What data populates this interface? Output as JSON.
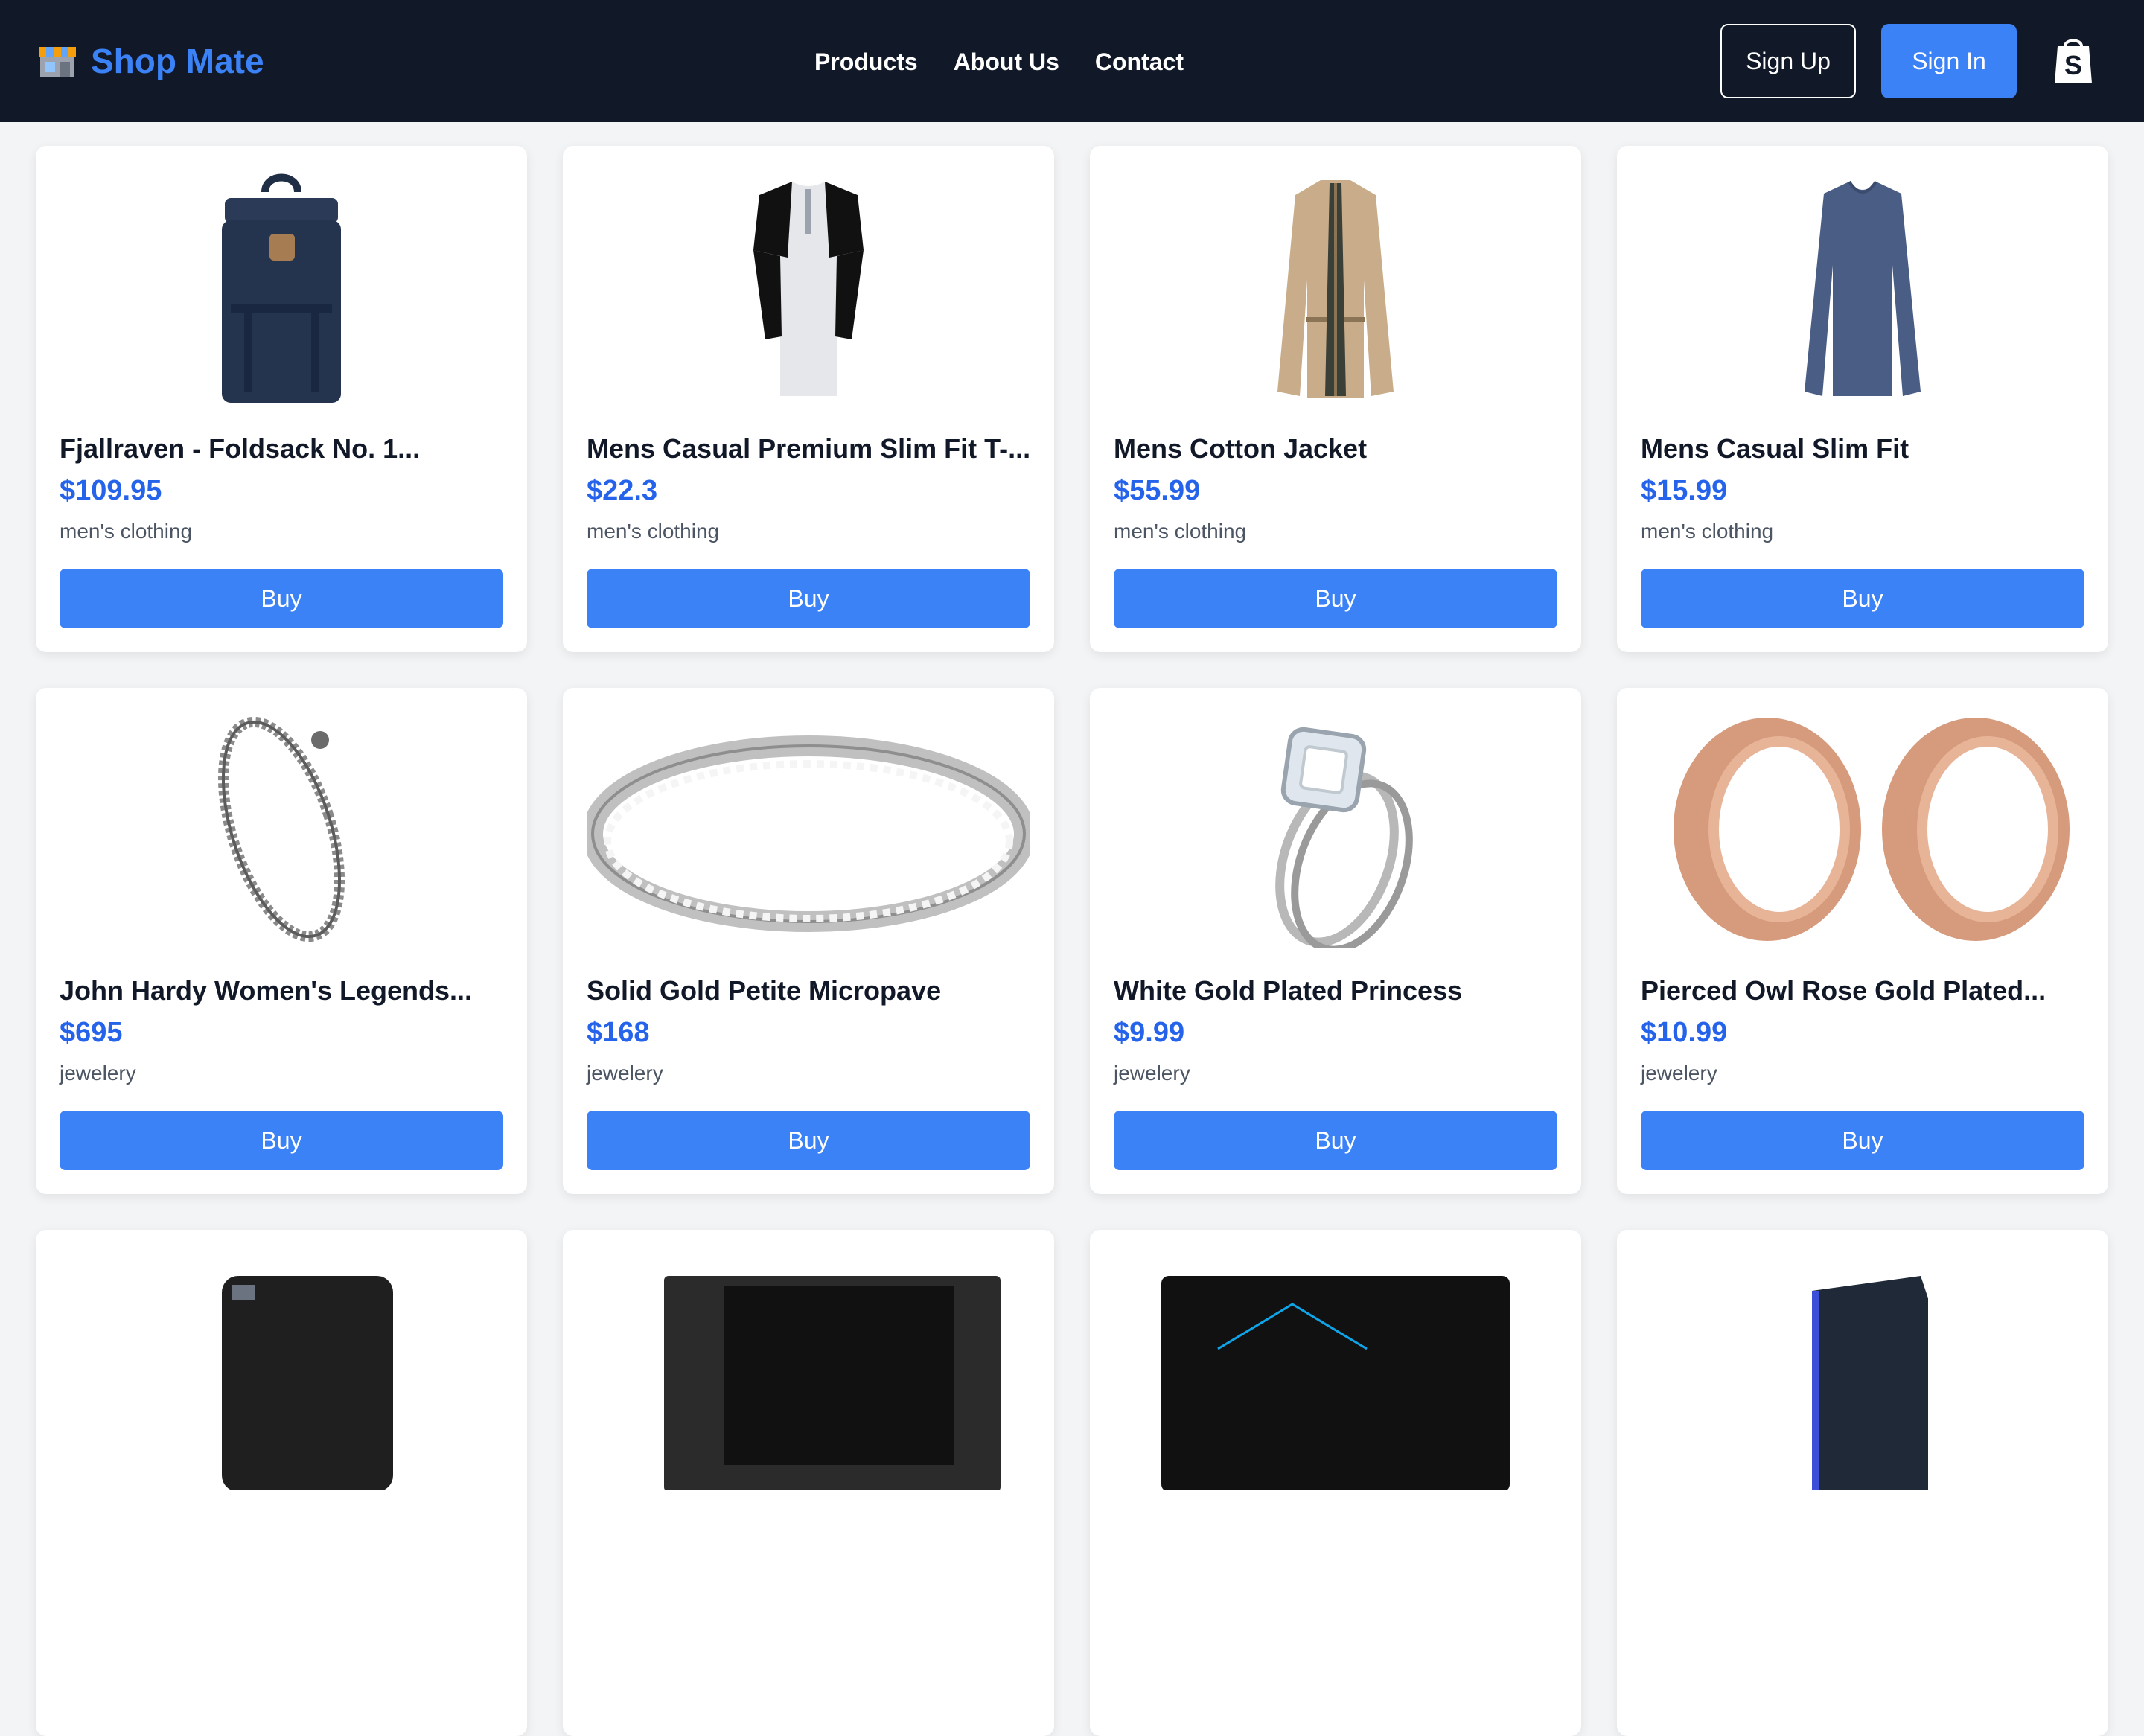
{
  "brand": {
    "name": "Shop Mate",
    "icon": "store-icon"
  },
  "nav": {
    "links": [
      "Products",
      "About Us",
      "Contact"
    ]
  },
  "auth": {
    "signup_label": "Sign Up",
    "signin_label": "Sign In"
  },
  "cart": {
    "icon": "shopping-bag-icon"
  },
  "colors": {
    "navbar": "#111827",
    "accent": "#3b82f6",
    "price": "#2563eb",
    "background": "#f3f4f6"
  },
  "products": [
    {
      "title": "Fjallraven - Foldsack No. 1...",
      "price": "$109.95",
      "category": "men's clothing",
      "buy": "Buy",
      "image": "backpack-image"
    },
    {
      "title": "Mens Casual Premium Slim Fit T-...",
      "price": "$22.3",
      "category": "men's clothing",
      "buy": "Buy",
      "image": "raglan-tshirt-image"
    },
    {
      "title": "Mens Cotton Jacket",
      "price": "$55.99",
      "category": "men's clothing",
      "buy": "Buy",
      "image": "cotton-jacket-image"
    },
    {
      "title": "Mens Casual Slim Fit",
      "price": "$15.99",
      "category": "men's clothing",
      "buy": "Buy",
      "image": "long-sleeve-shirt-image"
    },
    {
      "title": "John Hardy Women's Legends...",
      "price": "$695",
      "category": "jewelery",
      "buy": "Buy",
      "image": "dragon-bracelet-image"
    },
    {
      "title": "Solid Gold Petite Micropave",
      "price": "$168",
      "category": "jewelery",
      "buy": "Buy",
      "image": "micropave-ring-image"
    },
    {
      "title": "White Gold Plated Princess",
      "price": "$9.99",
      "category": "jewelery",
      "buy": "Buy",
      "image": "princess-ring-image"
    },
    {
      "title": "Pierced Owl Rose Gold Plated...",
      "price": "$10.99",
      "category": "jewelery",
      "buy": "Buy",
      "image": "rose-gold-tunnels-image"
    },
    {
      "image": "external-hard-drive-image"
    },
    {
      "image": "ssd-plus-image"
    },
    {
      "image": "silicon-power-ssd-image"
    },
    {
      "image": "portable-drive-image"
    }
  ]
}
